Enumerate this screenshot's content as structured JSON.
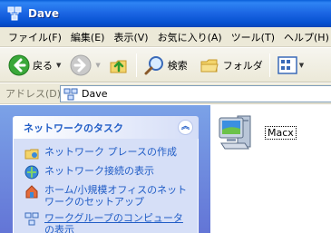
{
  "window": {
    "title": "Dave"
  },
  "menu": [
    "ファイル(F)",
    "編集(E)",
    "表示(V)",
    "お気に入り(A)",
    "ツール(T)",
    "ヘルプ(H)"
  ],
  "toolbar": {
    "back_label": "戻る",
    "search_label": "検索",
    "folders_label": "フォルダ"
  },
  "address": {
    "label": "アドレス(D)",
    "value": "Dave"
  },
  "tasks": {
    "title": "ネットワークのタスク",
    "items": [
      {
        "label": "ネットワーク プレースの作成",
        "icon": "network-place-icon"
      },
      {
        "label": "ネットワーク接続の表示",
        "icon": "network-connections-icon"
      },
      {
        "label": "ホーム/小規模オフィスのネットワークのセットアップ",
        "icon": "home-network-icon"
      },
      {
        "label": "ワークグループのコンピュータの表示",
        "icon": "workgroup-icon"
      }
    ]
  },
  "content": {
    "items": [
      {
        "label": "Macx",
        "icon": "computer-icon"
      }
    ]
  }
}
